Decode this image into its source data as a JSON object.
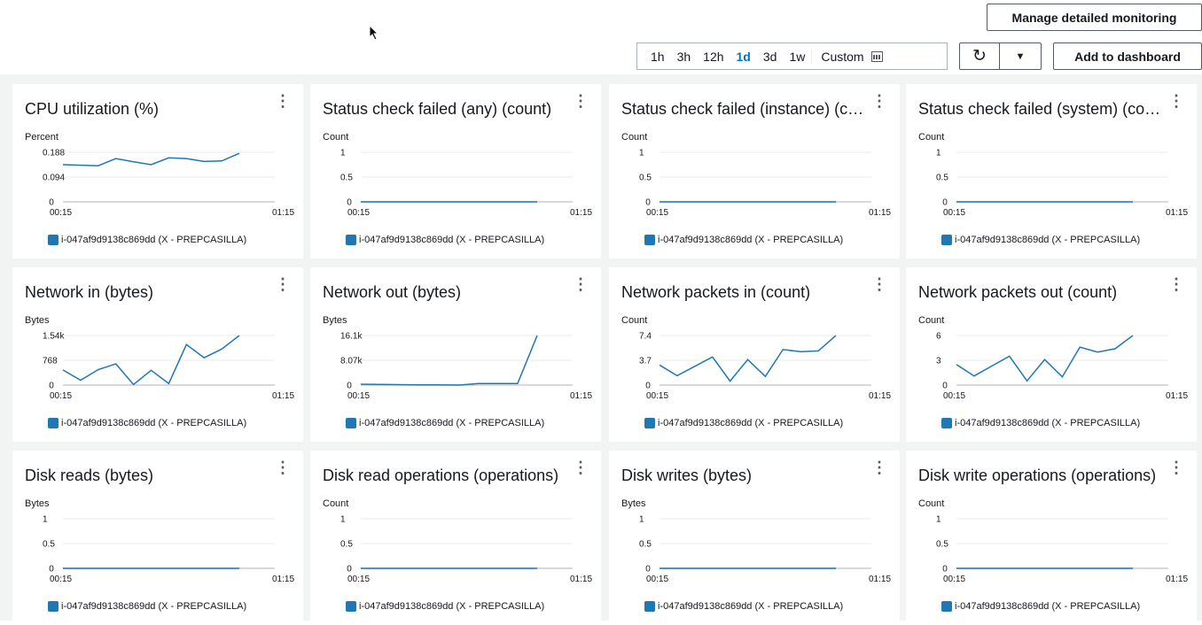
{
  "toolbar": {
    "manage_label": "Manage detailed monitoring",
    "add_label": "Add to dashboard",
    "ranges": [
      "1h",
      "3h",
      "12h",
      "1d",
      "3d",
      "1w"
    ],
    "active_range": "1d",
    "custom_label": "Custom",
    "refresh_icon": "refresh-icon",
    "dropdown_icon": "caret-down-icon"
  },
  "colors": {
    "series": "#1f77b4",
    "active": "#0073bb"
  },
  "widgets": [
    {
      "title": "CPU utilization (%)",
      "unit": "Percent",
      "legend": "i-047af9d9138c869dd (X - PREPCASILLA)",
      "chart_data": {
        "type": "line",
        "x_ticks": [
          "00:15",
          "01:15"
        ],
        "y_ticks": [
          "0",
          "0.094",
          "0.188"
        ],
        "ylim": [
          0,
          0.188
        ],
        "values": [
          0.141,
          0.139,
          0.137,
          0.164,
          0.152,
          0.141,
          0.167,
          0.164,
          0.153,
          0.155,
          0.184
        ]
      }
    },
    {
      "title": "Status check failed (any) (count)",
      "unit": "Count",
      "legend": "i-047af9d9138c869dd (X - PREPCASILLA)",
      "chart_data": {
        "type": "line",
        "x_ticks": [
          "00:15",
          "01:15"
        ],
        "y_ticks": [
          "0",
          "0.5",
          "1"
        ],
        "ylim": [
          0,
          1
        ],
        "values": [
          0,
          0,
          0,
          0,
          0,
          0,
          0,
          0,
          0,
          0,
          0
        ]
      }
    },
    {
      "title": "Status check failed (instance) (c…",
      "unit": "Count",
      "legend": "i-047af9d9138c869dd (X - PREPCASILLA)",
      "chart_data": {
        "type": "line",
        "x_ticks": [
          "00:15",
          "01:15"
        ],
        "y_ticks": [
          "0",
          "0.5",
          "1"
        ],
        "ylim": [
          0,
          1
        ],
        "values": [
          0,
          0,
          0,
          0,
          0,
          0,
          0,
          0,
          0,
          0,
          0
        ]
      }
    },
    {
      "title": "Status check failed (system) (co…",
      "unit": "Count",
      "legend": "i-047af9d9138c869dd (X - PREPCASILLA)",
      "chart_data": {
        "type": "line",
        "x_ticks": [
          "00:15",
          "01:15"
        ],
        "y_ticks": [
          "0",
          "0.5",
          "1"
        ],
        "ylim": [
          0,
          1
        ],
        "values": [
          0,
          0,
          0,
          0,
          0,
          0,
          0,
          0,
          0,
          0,
          0
        ]
      }
    },
    {
      "title": "Network in (bytes)",
      "unit": "Bytes",
      "legend": "i-047af9d9138c869dd (X - PREPCASILLA)",
      "chart_data": {
        "type": "line",
        "x_ticks": [
          "00:15",
          "01:15"
        ],
        "y_ticks": [
          "0",
          "768",
          "1.54k"
        ],
        "ylim": [
          0,
          1540
        ],
        "values": [
          470,
          150,
          480,
          660,
          20,
          460,
          50,
          1260,
          850,
          1120,
          1540
        ]
      }
    },
    {
      "title": "Network out (bytes)",
      "unit": "Bytes",
      "legend": "i-047af9d9138c869dd (X - PREPCASILLA)",
      "chart_data": {
        "type": "line",
        "x_ticks": [
          "00:15",
          "01:15"
        ],
        "y_ticks": [
          "0",
          "8.07k",
          "16.1k"
        ],
        "ylim": [
          0,
          16100
        ],
        "values": [
          300,
          200,
          150,
          100,
          50,
          0,
          500,
          500,
          500,
          16100
        ]
      }
    },
    {
      "title": "Network packets in (count)",
      "unit": "Count",
      "legend": "i-047af9d9138c869dd (X - PREPCASILLA)",
      "chart_data": {
        "type": "line",
        "x_ticks": [
          "00:15",
          "01:15"
        ],
        "y_ticks": [
          "0",
          "3.7",
          "7.4"
        ],
        "ylim": [
          0,
          7.4
        ],
        "values": [
          3.0,
          1.4,
          2.8,
          4.2,
          0.6,
          3.8,
          1.3,
          5.3,
          5.0,
          5.1,
          7.4
        ]
      }
    },
    {
      "title": "Network packets out (count)",
      "unit": "Count",
      "legend": "i-047af9d9138c869dd (X - PREPCASILLA)",
      "chart_data": {
        "type": "line",
        "x_ticks": [
          "00:15",
          "01:15"
        ],
        "y_ticks": [
          "0",
          "3",
          "6"
        ],
        "ylim": [
          0,
          6
        ],
        "values": [
          2.5,
          1.1,
          2.3,
          3.5,
          0.5,
          3.1,
          1.0,
          4.6,
          4.0,
          4.4,
          6.0
        ]
      }
    },
    {
      "title": "Disk reads (bytes)",
      "unit": "Bytes",
      "legend": "i-047af9d9138c869dd (X - PREPCASILLA)",
      "chart_data": {
        "type": "line",
        "x_ticks": [
          "00:15",
          "01:15"
        ],
        "y_ticks": [
          "0",
          "0.5",
          "1"
        ],
        "ylim": [
          0,
          1
        ],
        "values": [
          0,
          0,
          0,
          0,
          0,
          0,
          0,
          0,
          0,
          0,
          0
        ]
      }
    },
    {
      "title": "Disk read operations (operations)",
      "unit": "Count",
      "legend": "i-047af9d9138c869dd (X - PREPCASILLA)",
      "chart_data": {
        "type": "line",
        "x_ticks": [
          "00:15",
          "01:15"
        ],
        "y_ticks": [
          "0",
          "0.5",
          "1"
        ],
        "ylim": [
          0,
          1
        ],
        "values": [
          0,
          0,
          0,
          0,
          0,
          0,
          0,
          0,
          0,
          0,
          0
        ]
      }
    },
    {
      "title": "Disk writes (bytes)",
      "unit": "Bytes",
      "legend": "i-047af9d9138c869dd (X - PREPCASILLA)",
      "chart_data": {
        "type": "line",
        "x_ticks": [
          "00:15",
          "01:15"
        ],
        "y_ticks": [
          "0",
          "0.5",
          "1"
        ],
        "ylim": [
          0,
          1
        ],
        "values": [
          0,
          0,
          0,
          0,
          0,
          0,
          0,
          0,
          0,
          0,
          0
        ]
      }
    },
    {
      "title": "Disk write operations (operations)",
      "unit": "Count",
      "legend": "i-047af9d9138c869dd (X - PREPCASILLA)",
      "chart_data": {
        "type": "line",
        "x_ticks": [
          "00:15",
          "01:15"
        ],
        "y_ticks": [
          "0",
          "0.5",
          "1"
        ],
        "ylim": [
          0,
          1
        ],
        "values": [
          0,
          0,
          0,
          0,
          0,
          0,
          0,
          0,
          0,
          0,
          0
        ]
      }
    }
  ]
}
